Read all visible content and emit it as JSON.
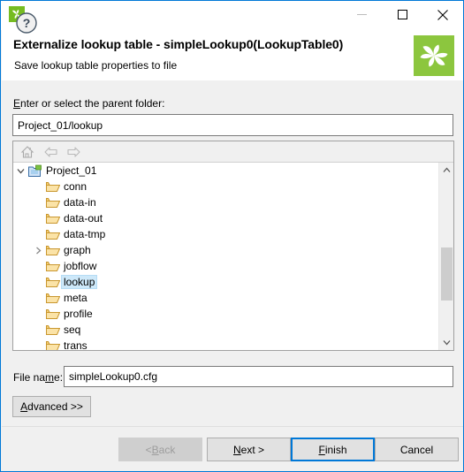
{
  "window": {
    "app_icon": "pinwheel-icon",
    "controls": {
      "minimize": "minimize-icon",
      "maximize": "maximize-icon",
      "close": "close-icon"
    }
  },
  "header": {
    "title": "Externalize lookup table - simpleLookup0(LookupTable0)",
    "subtitle": "Save lookup table properties to file",
    "logo": "pinwheel-logo",
    "logo_color": "#8cc63e"
  },
  "form": {
    "parent_folder_label": "Enter or select the parent folder:",
    "parent_folder_label_mnemonic": "E",
    "parent_folder_value": "Project_01/lookup",
    "file_name_label": "File name:",
    "file_name_label_mnemonic": "m",
    "file_name_value": "simpleLookup0.cfg",
    "advanced_label": "Advanced >>",
    "advanced_mnemonic": "A"
  },
  "tree_toolbar": {
    "home": "home-icon",
    "back": "back-arrow-icon",
    "forward": "forward-arrow-icon"
  },
  "tree": {
    "selected": "lookup",
    "nodes": [
      {
        "label": "Project_01",
        "icon": "project-folder-icon",
        "depth": 0,
        "expanded": true,
        "has_children": true,
        "selected": false
      },
      {
        "label": "conn",
        "icon": "folder-icon",
        "depth": 1,
        "expanded": false,
        "has_children": false,
        "selected": false
      },
      {
        "label": "data-in",
        "icon": "folder-icon",
        "depth": 1,
        "expanded": false,
        "has_children": false,
        "selected": false
      },
      {
        "label": "data-out",
        "icon": "folder-icon",
        "depth": 1,
        "expanded": false,
        "has_children": false,
        "selected": false
      },
      {
        "label": "data-tmp",
        "icon": "folder-icon",
        "depth": 1,
        "expanded": false,
        "has_children": false,
        "selected": false
      },
      {
        "label": "graph",
        "icon": "folder-icon",
        "depth": 1,
        "expanded": false,
        "has_children": true,
        "selected": false
      },
      {
        "label": "jobflow",
        "icon": "folder-icon",
        "depth": 1,
        "expanded": false,
        "has_children": false,
        "selected": false
      },
      {
        "label": "lookup",
        "icon": "folder-icon",
        "depth": 1,
        "expanded": false,
        "has_children": false,
        "selected": true
      },
      {
        "label": "meta",
        "icon": "folder-icon",
        "depth": 1,
        "expanded": false,
        "has_children": false,
        "selected": false
      },
      {
        "label": "profile",
        "icon": "folder-icon",
        "depth": 1,
        "expanded": false,
        "has_children": false,
        "selected": false
      },
      {
        "label": "seq",
        "icon": "folder-icon",
        "depth": 1,
        "expanded": false,
        "has_children": false,
        "selected": false
      },
      {
        "label": "trans",
        "icon": "folder-icon",
        "depth": 1,
        "expanded": false,
        "has_children": false,
        "selected": false
      }
    ],
    "selection_color": "#cde8f9",
    "scrollbar": {
      "thumb_color": "#cdcdcd",
      "up": "scroll-up-icon",
      "down": "scroll-down-icon"
    }
  },
  "footer": {
    "help": "help-icon",
    "buttons": [
      {
        "label": "< Back",
        "mnemonic": "B",
        "enabled": false,
        "default": false
      },
      {
        "label": "Next >",
        "mnemonic": "N",
        "enabled": true,
        "default": false
      },
      {
        "label": "Finish",
        "mnemonic": "F",
        "enabled": true,
        "default": true
      },
      {
        "label": "Cancel",
        "mnemonic": "",
        "enabled": true,
        "default": false
      }
    ],
    "default_button_border": "#0078d7"
  }
}
